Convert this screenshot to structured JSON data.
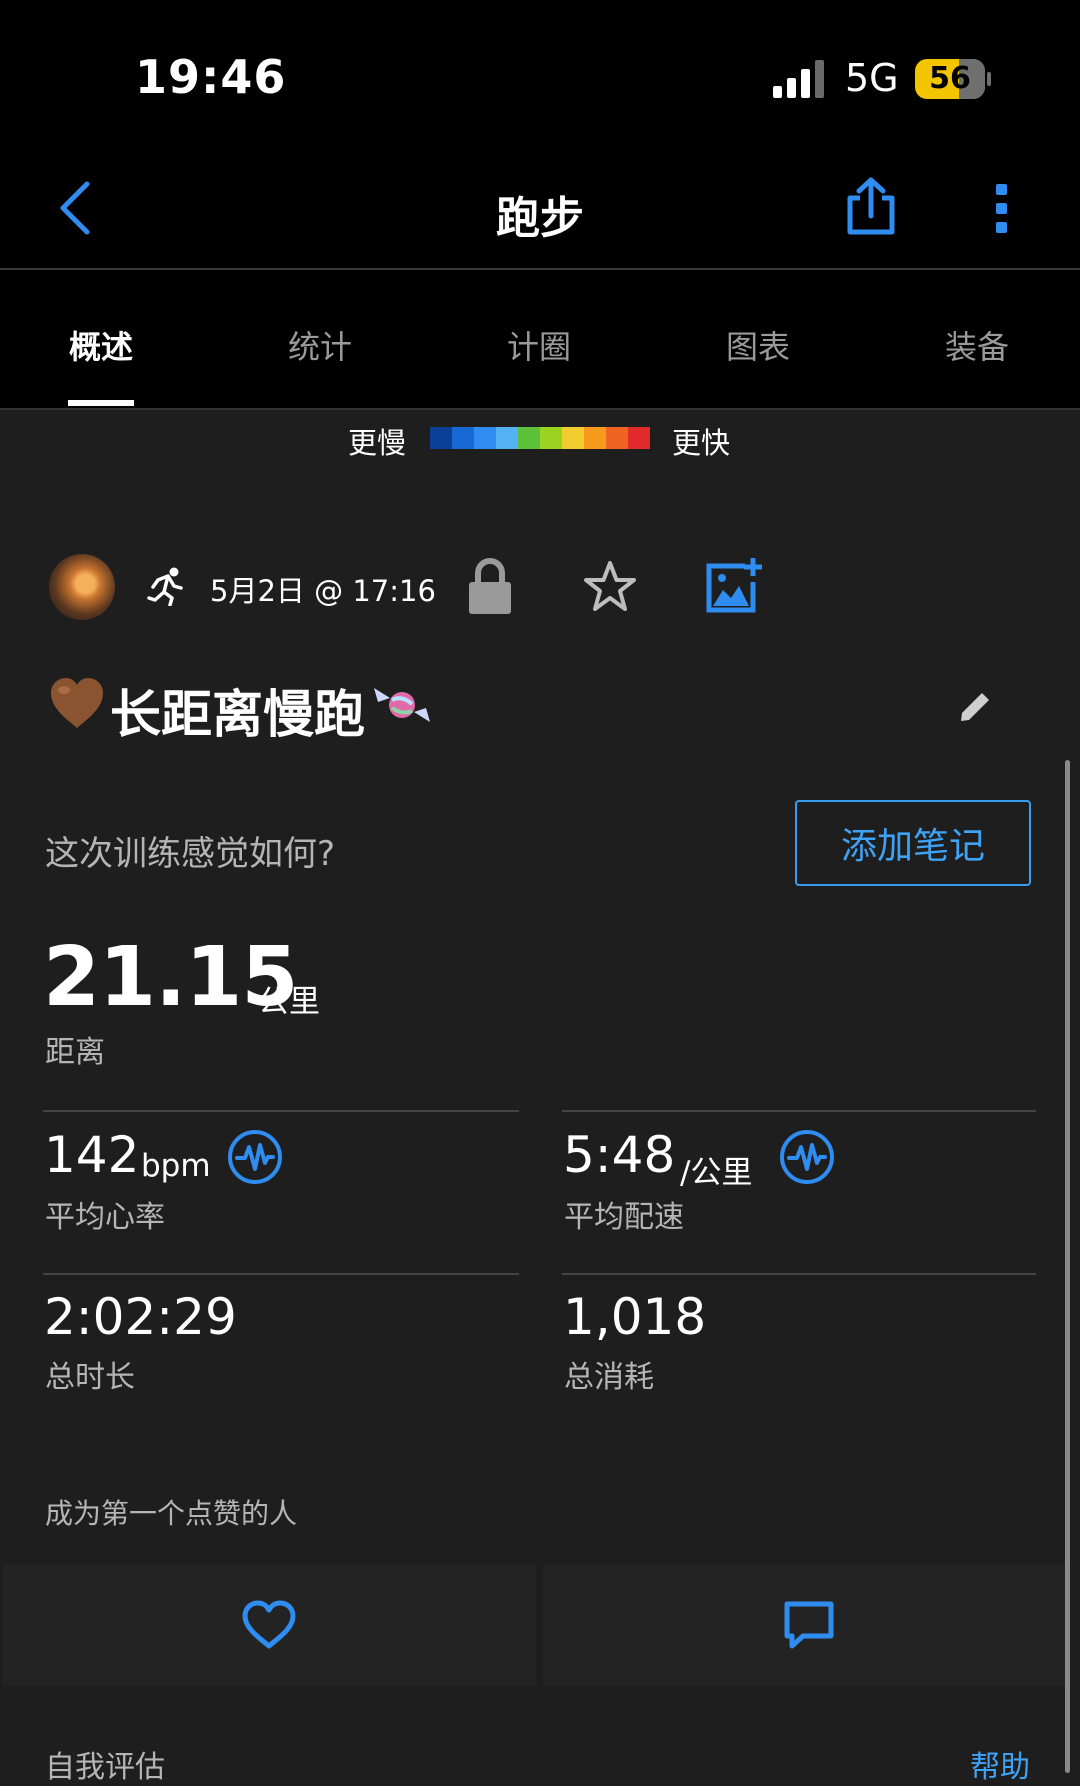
{
  "status_bar": {
    "time": "19:46",
    "network": "5G",
    "battery": "56"
  },
  "nav": {
    "title": "跑步",
    "back_icon": "chevron-left-icon",
    "share_icon": "share-icon",
    "more_icon": "more-vertical-icon"
  },
  "tabs": [
    {
      "label": "概述",
      "active": true
    },
    {
      "label": "统计",
      "active": false
    },
    {
      "label": "计圈",
      "active": false
    },
    {
      "label": "图表",
      "active": false
    },
    {
      "label": "装备",
      "active": false
    }
  ],
  "legend": {
    "slow": "更慢",
    "fast": "更快",
    "colors": [
      "#0c3f96",
      "#1769d6",
      "#2f8cf0",
      "#55b2f2",
      "#5cc03a",
      "#9ad321",
      "#f3cc30",
      "#f59a1d",
      "#ee6420",
      "#e22a2a"
    ]
  },
  "activity": {
    "date": "5月2日 @ 17:16",
    "title": "长距离慢跑",
    "feel_question": "这次训练感觉如何?",
    "add_note": "添加笔记"
  },
  "distance": {
    "value": "21.15",
    "unit": "公里",
    "label": "距离"
  },
  "stats": {
    "heart_rate": {
      "value": "142",
      "unit": "bpm",
      "label": "平均心率"
    },
    "pace": {
      "value": "5:48",
      "unit": "/公里",
      "label": "平均配速"
    },
    "duration": {
      "value": "2:02:29",
      "label": "总时长"
    },
    "calories": {
      "value": "1,018",
      "label": "总消耗"
    }
  },
  "social": {
    "like_prompt": "成为第一个点赞的人"
  },
  "footer": {
    "self_eval": "自我评估",
    "help": "帮助"
  },
  "colors": {
    "accent": "#3ea2f5",
    "background": "#1e1e1f",
    "battery": "#f3c500"
  }
}
